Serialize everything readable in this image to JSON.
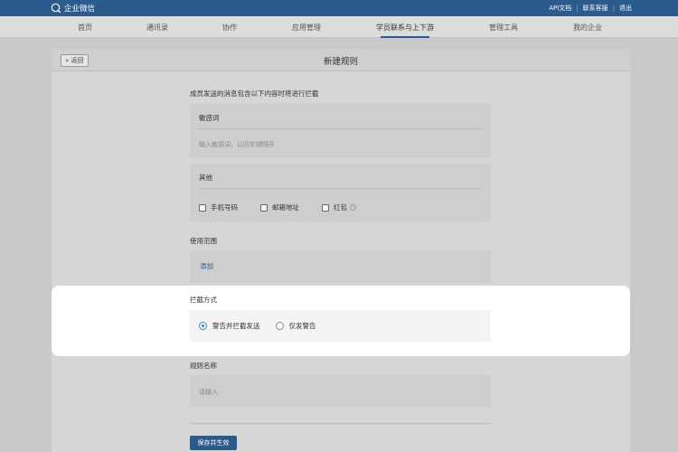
{
  "app": {
    "name": "企业微信"
  },
  "top_links": [
    "API文档",
    "联系客服",
    "退出"
  ],
  "nav": {
    "items": [
      "首页",
      "通讯录",
      "协作",
      "应用管理",
      "学员联系与上下游",
      "管理工具",
      "我的企业"
    ],
    "active_index": 4
  },
  "page": {
    "back_label": "« 返回",
    "title": "新建规则"
  },
  "form": {
    "intro_label": "成员发送的消息包含以下内容时将进行拦截",
    "sensitive": {
      "title": "敏感词",
      "placeholder": "输入敏感词，以回车键隔开"
    },
    "other": {
      "title": "其他",
      "options": [
        {
          "label": "手机号码",
          "checked": false
        },
        {
          "label": "邮箱地址",
          "checked": false
        },
        {
          "label": "红包",
          "checked": false,
          "has_info_icon": true
        }
      ]
    },
    "scope": {
      "label": "使用范围",
      "add_label": "添加"
    },
    "intercept": {
      "label": "拦截方式",
      "options": [
        {
          "label": "警告并拦截发送",
          "selected": true
        },
        {
          "label": "仅发警告",
          "selected": false
        }
      ]
    },
    "rule_name": {
      "label": "规则名称",
      "placeholder": "请输入"
    },
    "save_label": "保存并生效"
  },
  "colors": {
    "brand": "#2b5a8c",
    "radio_accent": "#3b82d6"
  }
}
